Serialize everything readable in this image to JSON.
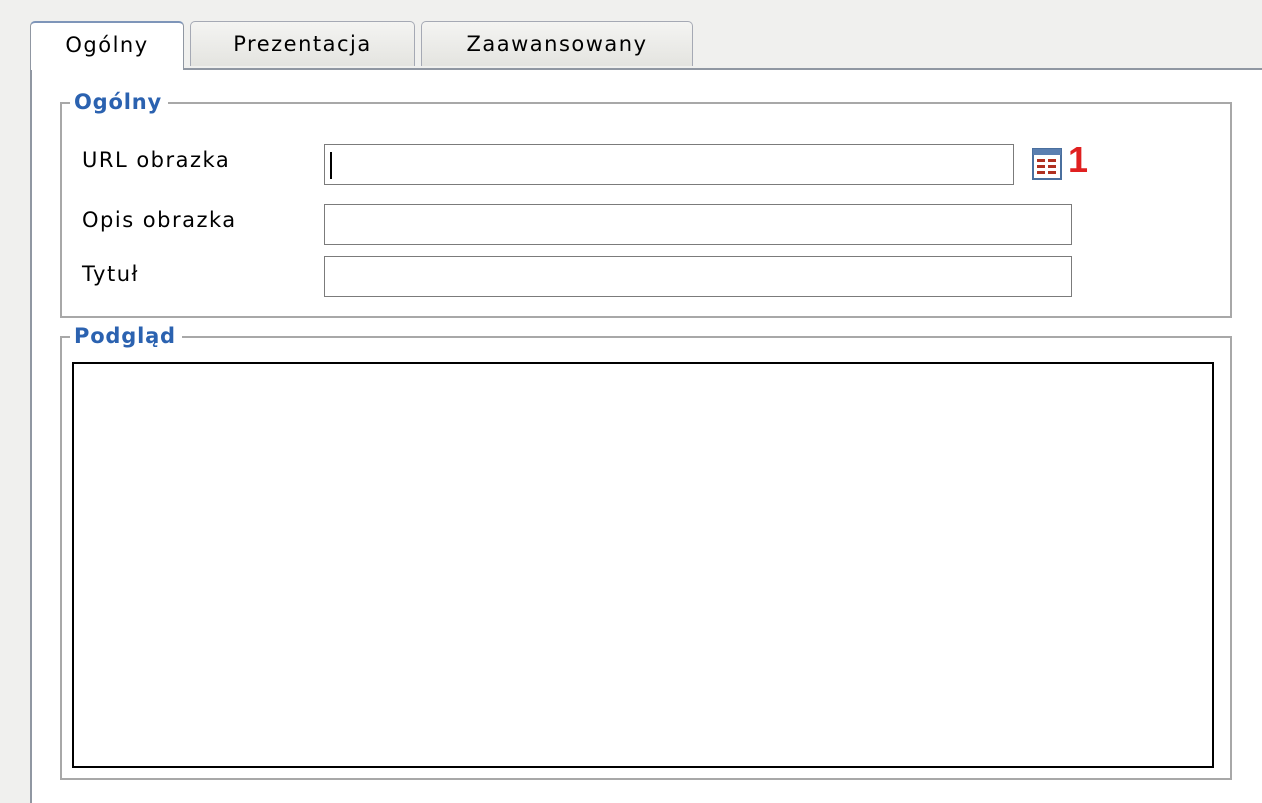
{
  "tabs": [
    {
      "label": "Ogólny",
      "active": true
    },
    {
      "label": "Prezentacja",
      "active": false
    },
    {
      "label": "Zaawansowany",
      "active": false
    }
  ],
  "general": {
    "legend": "Ogólny",
    "url_label": "URL obrazka",
    "url_value": "",
    "description_label": "Opis obrazka",
    "description_value": "",
    "title_label": "Tytuł",
    "title_value": "",
    "browse_icon": "image-browser-icon",
    "annotation_marker": "1"
  },
  "preview": {
    "legend": "Podgląd"
  },
  "colors": {
    "legend_text": "#2b62b0",
    "marker": "#e02020",
    "icon_accent": "#b03020"
  }
}
